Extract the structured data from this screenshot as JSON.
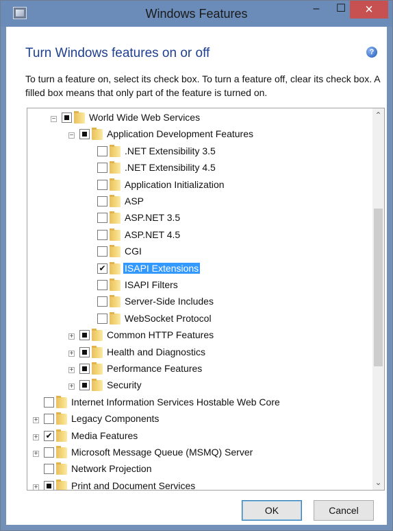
{
  "window": {
    "title": "Windows Features",
    "min_symbol": "–",
    "max_symbol": "☐",
    "close_symbol": "×",
    "icon_name": "windows-features-icon",
    "close_color": "#c75050",
    "titlebar_color": "#6b8cb8"
  },
  "main": {
    "heading": "Turn Windows features on or off",
    "help_symbol": "?",
    "description": "To turn a feature on, select its check box. To turn a feature off, clear its check box. A filled box means that only part of the feature is turned on."
  },
  "tree": {
    "items": [
      {
        "label": "World Wide Web Services",
        "state": "partial",
        "expander": "−"
      },
      {
        "label": "Application Development Features",
        "state": "partial",
        "expander": "−"
      },
      {
        "label": ".NET Extensibility 3.5",
        "state": "unchecked",
        "expander": ""
      },
      {
        "label": ".NET Extensibility 4.5",
        "state": "unchecked",
        "expander": ""
      },
      {
        "label": "Application Initialization",
        "state": "unchecked",
        "expander": ""
      },
      {
        "label": "ASP",
        "state": "unchecked",
        "expander": ""
      },
      {
        "label": "ASP.NET 3.5",
        "state": "unchecked",
        "expander": ""
      },
      {
        "label": "ASP.NET 4.5",
        "state": "unchecked",
        "expander": ""
      },
      {
        "label": "CGI",
        "state": "unchecked",
        "expander": ""
      },
      {
        "label": "ISAPI Extensions",
        "state": "checked",
        "expander": "",
        "selected": true
      },
      {
        "label": "ISAPI Filters",
        "state": "unchecked",
        "expander": ""
      },
      {
        "label": "Server-Side Includes",
        "state": "unchecked",
        "expander": ""
      },
      {
        "label": "WebSocket Protocol",
        "state": "unchecked",
        "expander": ""
      },
      {
        "label": "Common HTTP Features",
        "state": "partial",
        "expander": "+"
      },
      {
        "label": "Health and Diagnostics",
        "state": "partial",
        "expander": "+"
      },
      {
        "label": "Performance Features",
        "state": "partial",
        "expander": "+"
      },
      {
        "label": "Security",
        "state": "partial",
        "expander": "+"
      },
      {
        "label": "Internet Information Services Hostable Web Core",
        "state": "unchecked",
        "expander": ""
      },
      {
        "label": "Legacy Components",
        "state": "unchecked",
        "expander": "+"
      },
      {
        "label": "Media Features",
        "state": "checked",
        "expander": "+"
      },
      {
        "label": "Microsoft Message Queue (MSMQ) Server",
        "state": "unchecked",
        "expander": "+"
      },
      {
        "label": "Network Projection",
        "state": "unchecked",
        "expander": ""
      },
      {
        "label": "Print and Document Services",
        "state": "partial",
        "expander": "+"
      }
    ],
    "check_symbol": "✔",
    "scroll_up_symbol": "⌃",
    "scroll_down_symbol": "⌄",
    "selection_color": "#3399ff"
  },
  "buttons": {
    "ok": "OK",
    "cancel": "Cancel"
  }
}
